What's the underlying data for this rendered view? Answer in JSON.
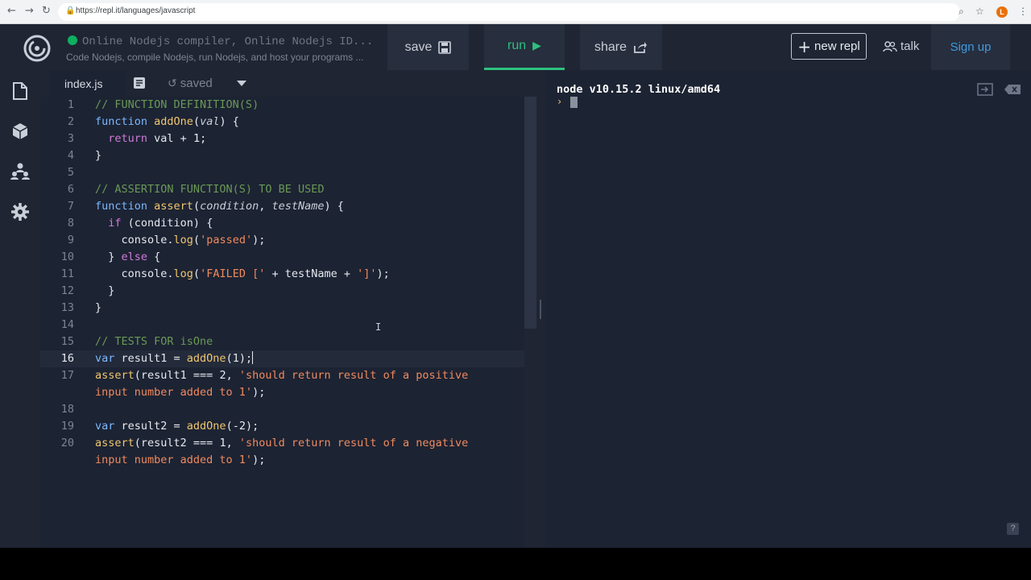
{
  "browser": {
    "url": "https://repl.it/languages/javascript",
    "avatar_letter": "L"
  },
  "header": {
    "title": "Online Nodejs compiler, Online Nodejs ID...",
    "subtitle": "Code Nodejs, compile Nodejs, run Nodejs, and host your programs ...",
    "save_label": "save",
    "run_label": "run",
    "share_label": "share",
    "new_repl_label": "new repl",
    "talk_label": "talk",
    "signup_label": "Sign up"
  },
  "editor": {
    "tab_name": "index.js",
    "saved_label": "saved",
    "active_line": 16,
    "lines": [
      {
        "n": "1",
        "html": "<span class=\"c\">// FUNCTION DEFINITION(S)</span>"
      },
      {
        "n": "2",
        "html": "<span class=\"k\">function</span> <span class=\"f\">addOne</span>(<span class=\"p\">val</span>) {"
      },
      {
        "n": "3",
        "html": "  <span class=\"r\">return</span> val + 1;"
      },
      {
        "n": "4",
        "html": "}"
      },
      {
        "n": "5",
        "html": ""
      },
      {
        "n": "6",
        "html": "<span class=\"c\">// ASSERTION FUNCTION(S) TO BE USED</span>"
      },
      {
        "n": "7",
        "html": "<span class=\"k\">function</span> <span class=\"f\">assert</span>(<span class=\"p\">condition</span>, <span class=\"p\">testName</span>) {"
      },
      {
        "n": "8",
        "html": "  <span class=\"r\">if</span> (condition) {"
      },
      {
        "n": "9",
        "html": "    console.<span class=\"f\">log</span>(<span class=\"s\">'passed'</span>);"
      },
      {
        "n": "10",
        "html": "  } <span class=\"r\">else</span> {"
      },
      {
        "n": "11",
        "html": "    console.<span class=\"f\">log</span>(<span class=\"s\">'FAILED ['</span> + testName + <span class=\"s\">']'</span>);"
      },
      {
        "n": "12",
        "html": "  }"
      },
      {
        "n": "13",
        "html": "}"
      },
      {
        "n": "14",
        "html": ""
      },
      {
        "n": "15",
        "html": "<span class=\"c\">// TESTS FOR isOne</span>"
      },
      {
        "n": "16",
        "html": "<span class=\"k\">var</span> result1 = <span class=\"f\">addOne</span>(1);<span class=\"caret-bar\"></span>"
      },
      {
        "n": "17",
        "html": "<span class=\"f\">assert</span>(result1 === 2, <span class=\"s\">'should return result of a positive</span>"
      },
      {
        "n": "",
        "html": "<span class=\"s\">input number added to 1'</span>);"
      },
      {
        "n": "18",
        "html": ""
      },
      {
        "n": "19",
        "html": "<span class=\"k\">var</span> result2 = <span class=\"f\">addOne</span>(-2);"
      },
      {
        "n": "20",
        "html": "<span class=\"f\">assert</span>(result2 === 1, <span class=\"s\">'should return result of a negative</span>"
      },
      {
        "n": "",
        "html": "<span class=\"s\">input number added to 1'</span>);"
      }
    ]
  },
  "console": {
    "version_line": "node v10.15.2 linux/amd64",
    "prompt": "›",
    "help_label": "?"
  },
  "colors": {
    "run_accent": "#2ec07f",
    "signup_accent": "#3e9ae0",
    "background": "#1c2333"
  }
}
